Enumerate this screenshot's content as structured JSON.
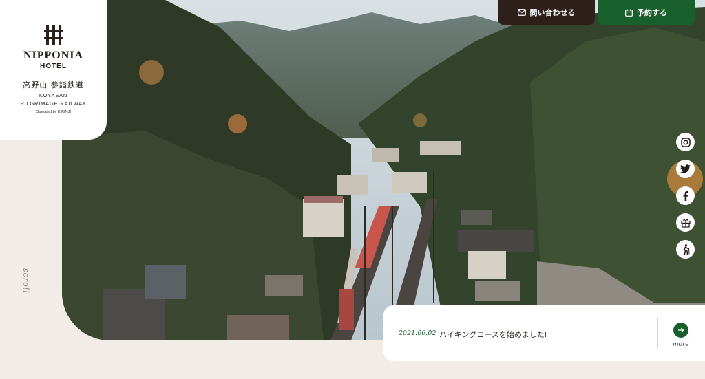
{
  "brand": {
    "name_main": "NIPPONIA",
    "name_sub": "HOTEL",
    "name_jp": "高野山 参詣鉄道",
    "line1": "KOYASAN",
    "line2": "PILGRIMAGE RAILWAY",
    "operator": "Operated by KIRINJI"
  },
  "header": {
    "contact_label": "問い合わせる",
    "reserve_label": "予約する"
  },
  "social": [
    "instagram-icon",
    "twitter-icon",
    "facebook-icon",
    "gift-icon",
    "hiking-icon"
  ],
  "scroll_label": "scroll",
  "news": {
    "date": "2021.06.02",
    "title": "ハイキングコースを始めました!",
    "more_label": "more"
  },
  "colors": {
    "green": "#185f2c",
    "dark_brown": "#2e211c",
    "background": "#f1ede6"
  }
}
